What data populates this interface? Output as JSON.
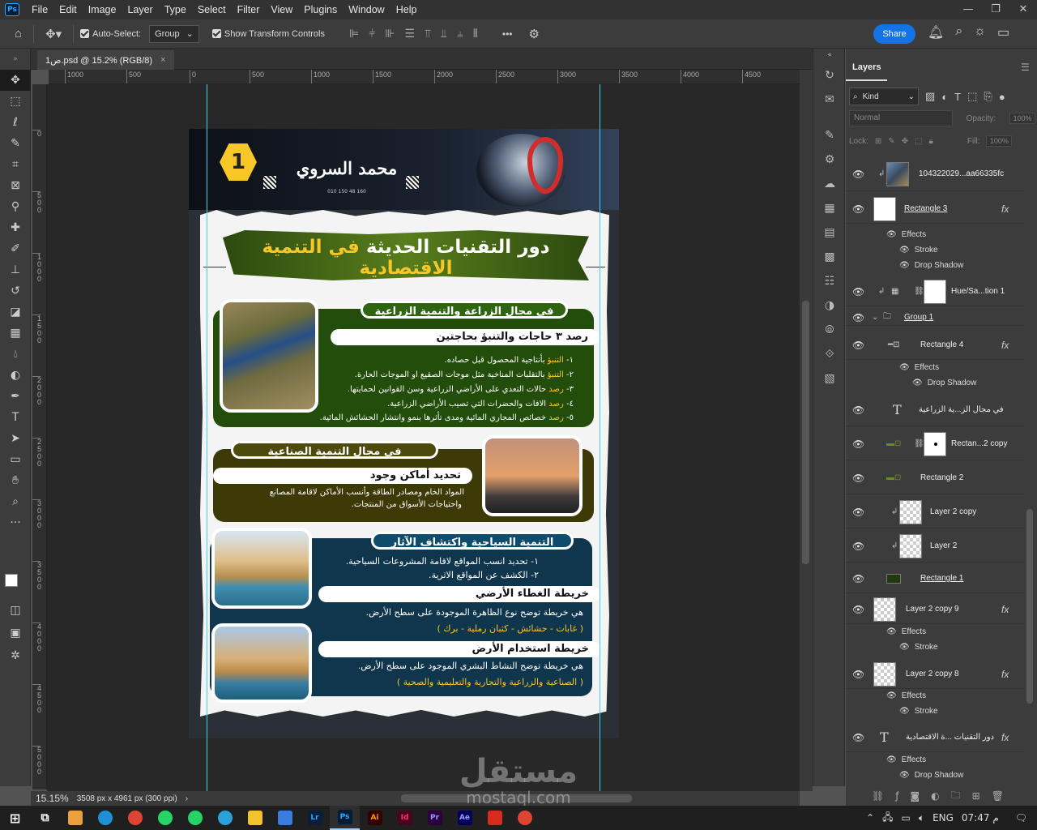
{
  "menubar": {
    "logo": "Ps",
    "items": [
      "File",
      "Edit",
      "Image",
      "Layer",
      "Type",
      "Select",
      "Filter",
      "View",
      "Plugins",
      "Window",
      "Help"
    ],
    "window_controls": [
      "—",
      "❐",
      "✕"
    ]
  },
  "options": {
    "auto_select_label": "Auto-Select:",
    "auto_select_value": "Group",
    "transform_label": "Show Transform Controls",
    "share_label": "Share",
    "more_glyph": "•••"
  },
  "document": {
    "tab_title": "ص1.psd @ 15.2% (RGB/8)",
    "close_glyph": "×",
    "zoom": "15.15%",
    "dimensions": "3508 px x 4961 px (300 ppi)"
  },
  "ruler": {
    "h_ticks": [
      "1000",
      "500",
      "0",
      "500",
      "1000",
      "1500",
      "2000",
      "2500",
      "3000",
      "3500",
      "4000",
      "4500"
    ],
    "v_ticks": [
      "0",
      "5 0 0",
      "1 0 0 0",
      "1 5 0 0",
      "2 0 0 0",
      "2 5 0 0",
      "3 0 0 0",
      "3 5 0 0",
      "4 0 0 0",
      "4 5 0 0",
      "5 0 0 0"
    ]
  },
  "poster": {
    "badge": "1",
    "author": "محمد السروي",
    "phone": "010 150 48 160",
    "title_part1": "دور التقنيات الحديثة",
    "title_part2": " في التنمية الاقتصادية",
    "sec1_pill": "في مجال الزراعة والتنمية الزراعية",
    "sec1_sub": "رصد ٣ حاجات والتنبؤ بحاجتين",
    "sec1_lines": [
      {
        "kw": "التنبؤ",
        "text": " بأنتاجية المحصول قبل حصاده.",
        "num": "١- "
      },
      {
        "kw": "التنبؤ",
        "text": " بالتقلبات المناخية مثل موجات الصقيع او الموجات الحارة.",
        "num": "٢- "
      },
      {
        "kw": "رصد",
        "text": " حالات التعدي على الأراضي الزراعية وسن القوانين لحمايتها.",
        "num": "٣- "
      },
      {
        "kw": "رصد",
        "text": " الافات والحضرات التي تصيب الأراضي الزراعية.",
        "num": "٤- "
      },
      {
        "kw": "رصد",
        "text": " خصائص المجاري المائية ومدى تأثرها بنمو وانتشار الحشائش المائية.",
        "num": "٥- "
      }
    ],
    "sec2_pill": "في مجال التنمية الصناعية",
    "sec2_sub": "تحديد أماكن وجود",
    "sec2_lines": [
      "المواد الخام ومصادر الطاقة وأنسب الأماكن لاقامة المصانع",
      "واحتياجات الأسواق من المنتجات."
    ],
    "sec3_pill": "التنمية السياحية واكتشاف الآثار",
    "sec3_lines": [
      "١- تحديد انسب المواقع لاقامة المشروعات السياحية.",
      "٢- الكشف عن المواقع الاثرية."
    ],
    "sec3_sub1": "خريطة الغطاء الأرضي",
    "sec3_text1": "هي خريطة توضح نوع الظاهرة الموجودة على سطح الأرض.",
    "sec3_yellow1": "( غابات - حشائش - كثبان رملية - برك )",
    "sec3_sub2": "خريطة استخدام الأرض",
    "sec3_text2": "هي خريطة توضح النشاط البشري  الموجود على سطح الأرض.",
    "sec3_yellow2": "( الصناعية والزراعية والتجارية والتعليمية والصحية )"
  },
  "layers": {
    "tab": "Layers",
    "kind": "Kind",
    "blend": "Normal",
    "opacity_label": "Opacity:",
    "opacity": "100%",
    "lock_label": "Lock:",
    "fill_label": "Fill:",
    "fill": "100%",
    "effects_label": "Effects",
    "stroke_label": "Stroke",
    "drop_shadow_label": "Drop Shadow",
    "fx": "fx",
    "t_glyph": "T",
    "rows": {
      "photo": "104322029...aa66335fc",
      "rect3": "Rectangle 3",
      "hue": "Hue/Sa...tion 1",
      "group1": "Group 1",
      "rect4": "Rectangle 4",
      "text_agri": "في مجال الز...ية الزراعية",
      "rect2copy": "Rectan...2 copy",
      "rect2": "Rectangle 2",
      "layer2copy": "Layer 2 copy",
      "layer2": "Layer 2",
      "rect1": "Rectangle 1",
      "layer2copy9": "Layer 2 copy 9",
      "layer2copy8": "Layer 2 copy 8",
      "text_title": "دور التقنيات ...ة الاقتصادية"
    }
  },
  "taskbar": {
    "apps": [
      {
        "label": "Lr",
        "color": "#0a1e3a"
      },
      {
        "label": "Ps",
        "color": "#001e36"
      },
      {
        "label": "Ai",
        "color": "#330000"
      },
      {
        "label": "Id",
        "color": "#49021f"
      },
      {
        "label": "Pr",
        "color": "#2a003d"
      },
      {
        "label": "Ae",
        "color": "#00005b"
      }
    ],
    "lang": "ENG",
    "time": "07:47 م"
  },
  "watermark": {
    "arabic": "مستقل",
    "latin": "mostaql.com"
  },
  "colors": {
    "accent": "#1473e6",
    "guide": "#3fd3e8",
    "highlight": "#f7c627"
  }
}
